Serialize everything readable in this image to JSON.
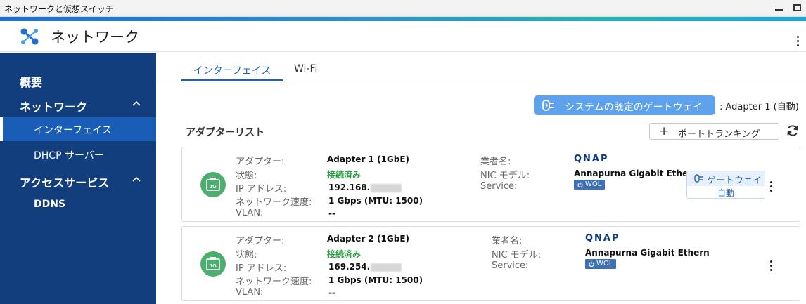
{
  "window": {
    "title": "ネットワークと仮想スイッチ"
  },
  "app": {
    "title": "ネットワーク",
    "icon": "network-switch-icon"
  },
  "sidebar": {
    "items": [
      {
        "label": "概要"
      },
      {
        "label": "ネットワーク"
      },
      {
        "label": "インターフェイス"
      },
      {
        "label": "DHCP サーバー"
      },
      {
        "label": "アクセスサービス"
      },
      {
        "label": "DDNS"
      }
    ]
  },
  "tabs": [
    {
      "label": "インターフェイス",
      "active": true
    },
    {
      "label": "Wi-Fi",
      "active": false
    }
  ],
  "toolbar": {
    "gateway_button": "システムの既定のゲートウェイ",
    "gateway_status": ": Adapter 1 (自動)",
    "list_title": "アダプターリスト",
    "trunking_button": "ポートトランキング"
  },
  "labels": {
    "adapter": "アダプター:",
    "status": "状態:",
    "ip": "IP アドレス:",
    "speed": "ネットワーク速度:",
    "vlan": "VLAN:",
    "vendor": "業者名:",
    "nic_model": "NIC モデル:",
    "service": "Service:"
  },
  "adapters": [
    {
      "port_badge": "1G",
      "name": "Adapter 1 (1GbE)",
      "status": "接続済み",
      "ip": "192.168.",
      "speed": "1 Gbps (MTU: 1500)",
      "vlan": "--",
      "vendor": "QNAP",
      "nic_model": "Annapurna Gigabit Ethern",
      "service": "WOL",
      "gateway_label": "ゲートウェイ",
      "gateway_mode": "自動"
    },
    {
      "port_badge": "1G",
      "name": "Adapter 2 (1GbE)",
      "status": "接続済み",
      "ip": "169.254.",
      "speed": "1 Gbps (MTU: 1500)",
      "vlan": "--",
      "vendor": "QNAP",
      "nic_model": "Annapurna Gigabit Ethern",
      "service": "WOL"
    }
  ],
  "colors": {
    "sidebar_bg": "#123e7d",
    "sidebar_active": "#1a5db7",
    "accent": "#1f5fb8",
    "gateway_button": "#5ea2ee",
    "connected": "#2e9e47",
    "port_icon": "#4caf70"
  }
}
